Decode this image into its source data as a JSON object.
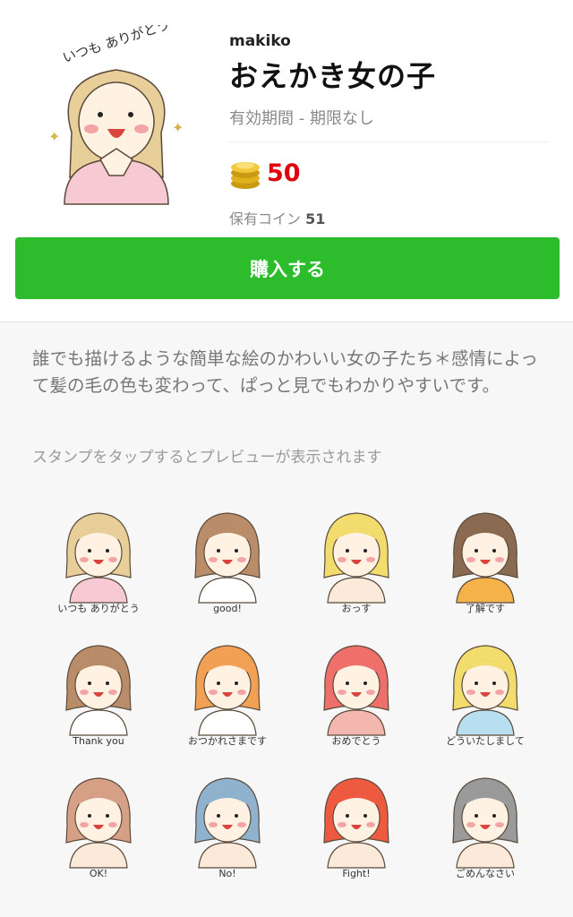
{
  "header": {
    "author": "makiko",
    "title": "おえかき女の子",
    "validity": "有効期間 - 期限なし",
    "price": "50",
    "owned_label": "保有コイン",
    "owned_count": "51"
  },
  "buy_button": {
    "label": "購入する"
  },
  "description": "誰でも描けるような簡単な絵のかわいい女の子たち＊感情によって髪の毛の色も変わって、ぱっと見でもわかりやすいです。",
  "hint": "スタンプをタップするとプレビューが表示されます",
  "main_sticker": {
    "caption": "いつも ありがとう",
    "hair": "#e8cf9a",
    "dress": "#f7c9d2"
  },
  "stickers": [
    {
      "caption": "いつも ありがとう",
      "hair": "#e8cf9a",
      "outfit": "#f7c9d2"
    },
    {
      "caption": "good!",
      "hair": "#b98c6a",
      "outfit": "#ffffff"
    },
    {
      "caption": "おっす",
      "hair": "#f3dc6e",
      "outfit": "#fbe9da"
    },
    {
      "caption": "了解です",
      "hair": "#8a6a50",
      "outfit": "#f5b24a"
    },
    {
      "caption": "Thank you",
      "hair": "#b98c6a",
      "outfit": "#ffffff"
    },
    {
      "caption": "おつかれさまです",
      "hair": "#f2a053",
      "outfit": "#ffffff"
    },
    {
      "caption": "おめでとう",
      "hair": "#ef6f6a",
      "outfit": "#f3b7b0"
    },
    {
      "caption": "どういたしまして",
      "hair": "#f3dc6e",
      "outfit": "#b8dff0"
    },
    {
      "caption": "OK!",
      "hair": "#d6a087",
      "outfit": "#fbe9da"
    },
    {
      "caption": "No!",
      "hair": "#8fb3cf",
      "outfit": "#fbe9da"
    },
    {
      "caption": "Fight!",
      "hair": "#ee5a3f",
      "outfit": "#fbe9da"
    },
    {
      "caption": "ごめんなさい",
      "hair": "#9a9a9a",
      "outfit": "#fbe9da"
    }
  ]
}
